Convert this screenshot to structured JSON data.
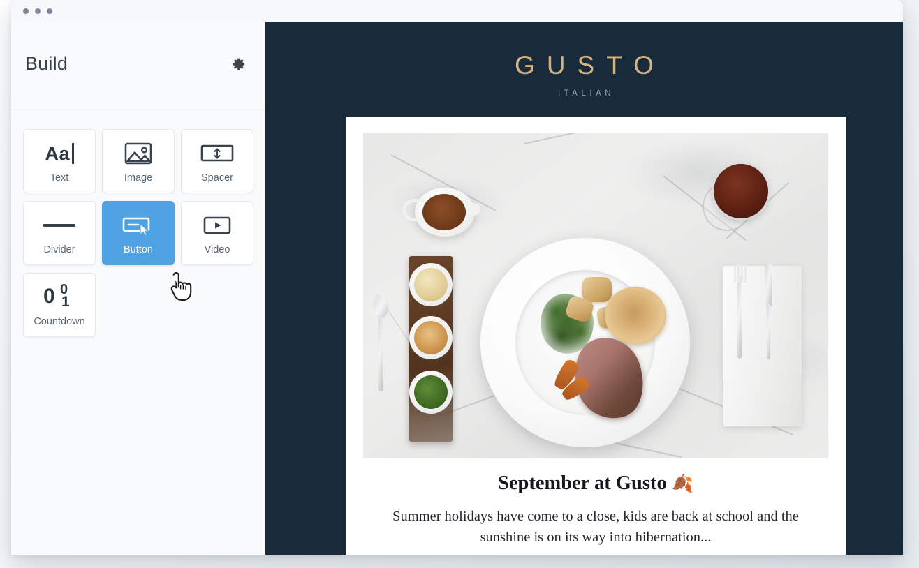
{
  "window": {
    "traffic_dots": 3
  },
  "sidebar": {
    "title": "Build",
    "settings_icon": "gear-icon",
    "blocks": [
      {
        "label": "Text",
        "icon": "text-aa-icon",
        "selected": false
      },
      {
        "label": "Image",
        "icon": "image-icon",
        "selected": false
      },
      {
        "label": "Spacer",
        "icon": "spacer-icon",
        "selected": false
      },
      {
        "label": "Divider",
        "icon": "divider-icon",
        "selected": false
      },
      {
        "label": "Button",
        "icon": "button-icon",
        "selected": true
      },
      {
        "label": "Video",
        "icon": "video-play-icon",
        "selected": false
      },
      {
        "label": "Countdown",
        "icon": "countdown-icon",
        "selected": false
      }
    ],
    "text_icon_glyph": "Aa",
    "countdown_glyph": {
      "zero": "0",
      "top": "0",
      "bottom": "1"
    }
  },
  "cursor": {
    "type": "pointing-hand-cursor"
  },
  "preview": {
    "brand_name": "GUSTO",
    "brand_subtitle": "ITALIAN",
    "heading": "September at Gusto",
    "heading_emoji": "🍂",
    "body": "Summer holidays have come to a close, kids are back at school and the sunshine is on its way into hibernation...",
    "hero_image_alt": "roast dinner flat lay on marble"
  },
  "colors": {
    "accent_blue": "#4fa3e3",
    "email_navy": "#182b3b",
    "brand_gold": "#d3b183",
    "sidebar_bg": "#f9fafb",
    "tile_border": "#e4e8ed",
    "label_gray": "#5b6674"
  }
}
